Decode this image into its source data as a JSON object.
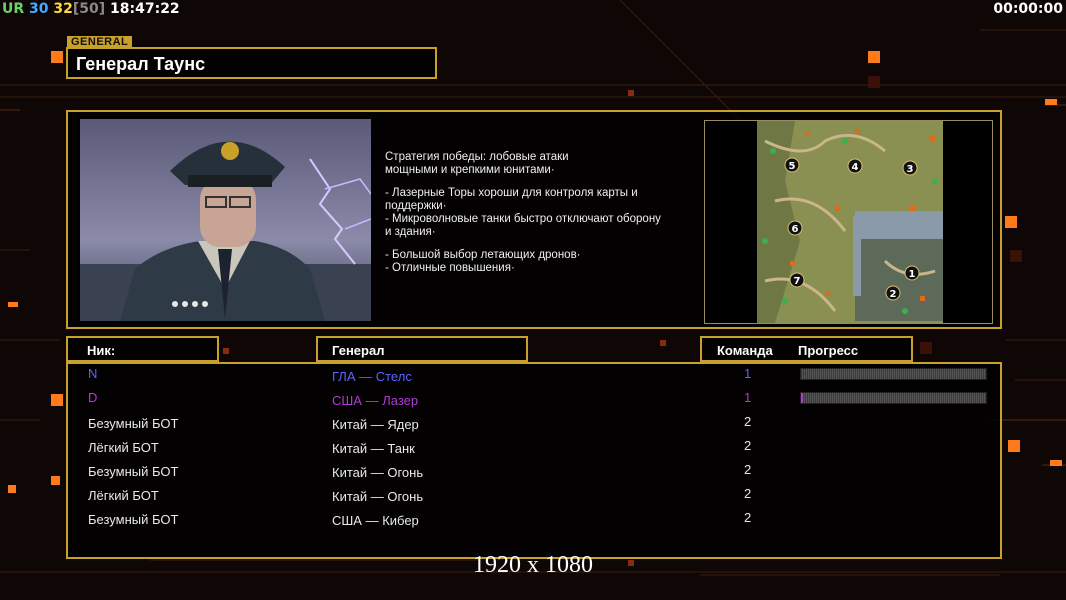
{
  "hud": {
    "ur": "UR",
    "n1": "30",
    "n2": "32",
    "n3": "[50]",
    "time": "18:47:22",
    "timer": "00:00:00"
  },
  "general_tag": "GENERAL",
  "general_name": "Генерал Таунс",
  "description": {
    "strategy": [
      "Стратегия победы: лобовые атаки",
      "мощными и крепкими юнитами·"
    ],
    "tips": [
      [
        "- Лазерные Торы хороши для контроля карты и",
        " поддержки·"
      ],
      [
        "- Микроволновые танки быстро отключают оборону",
        " и здания·"
      ],
      [
        "- Большой выбор летающих дронов·"
      ],
      [
        "- Отличные повышения·"
      ]
    ]
  },
  "minimap": {
    "markers": [
      "5",
      "4",
      "3",
      "6",
      "1",
      "7",
      "2"
    ]
  },
  "table": {
    "col_nick": "Ник:",
    "col_general": "Генерал",
    "col_team": "Команда",
    "col_progress": "Прогресс",
    "rows": [
      {
        "nick": "N",
        "general": "ГЛА — Стелс",
        "team": "1",
        "color": "#5a63ff",
        "progress": 0.0
      },
      {
        "nick": "D",
        "general": "США — Лазер",
        "team": "1",
        "color": "#b03ad8",
        "progress": 0.01
      },
      {
        "nick": "Безумный БОТ",
        "general": "Китай — Ядер",
        "team": "2",
        "color": "#ffffff"
      },
      {
        "nick": "Лёгкий БОТ",
        "general": "Китай — Танк",
        "team": "2",
        "color": "#ffffff"
      },
      {
        "nick": "Безумный БОТ",
        "general": "Китай — Огонь",
        "team": "2",
        "color": "#ffffff"
      },
      {
        "nick": "Лёгкий БОТ",
        "general": "Китай — Огонь",
        "team": "2",
        "color": "#ffffff"
      },
      {
        "nick": "Безумный БОТ",
        "general": "США — Кибер",
        "team": "2",
        "color": "#ffffff"
      }
    ]
  },
  "resolution": "1920 x 1080",
  "colors": {
    "accent": "#c8a02a",
    "background": "#0e0706",
    "orange": "#ff7a1a"
  }
}
